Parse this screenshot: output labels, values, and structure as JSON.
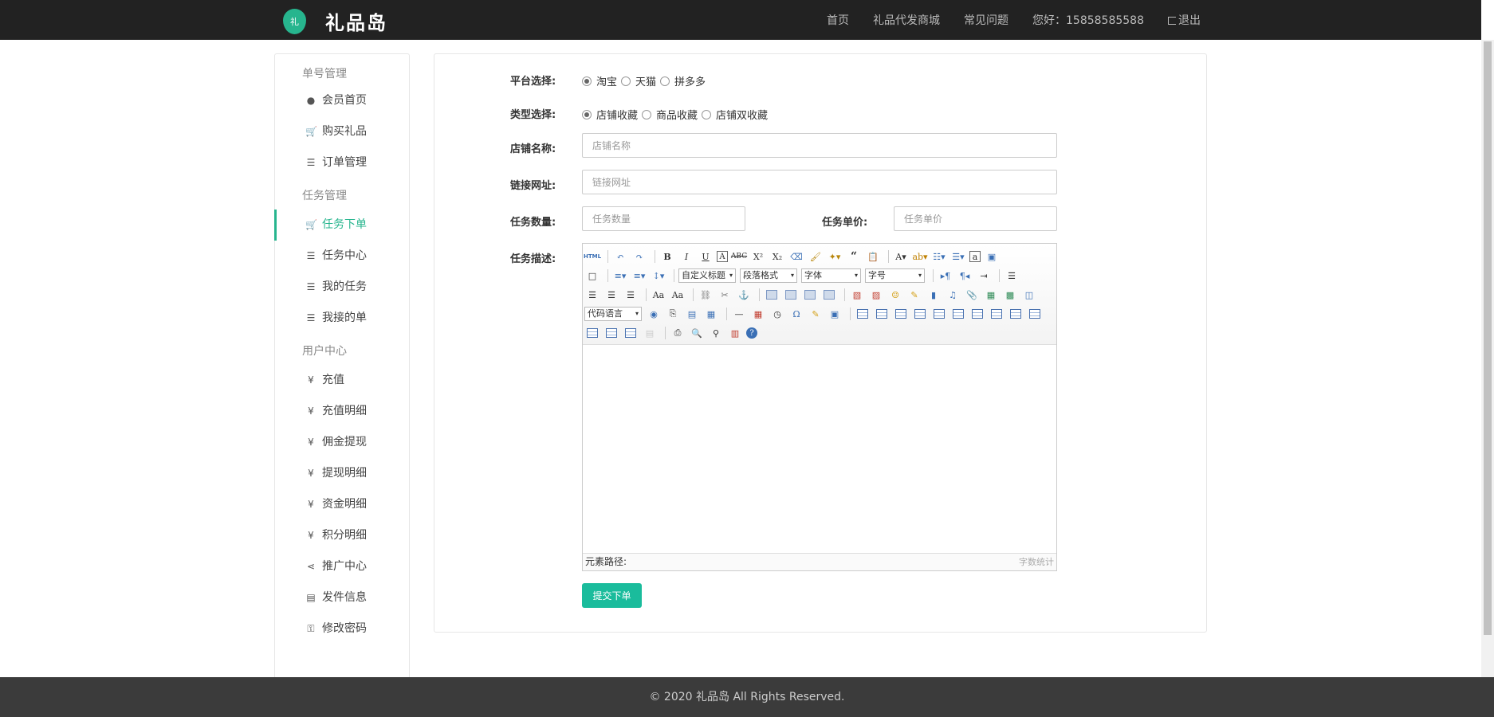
{
  "header": {
    "logo_badge": "礼",
    "logo_text": "礼品岛",
    "nav": [
      "首页",
      "礼品代发商城",
      "常见问题"
    ],
    "greeting": "您好：15858585588",
    "logout": "退出"
  },
  "sidebar": {
    "groups": [
      {
        "title": "单号管理",
        "items": [
          {
            "icon": "user-circle-icon",
            "label": "会员首页"
          },
          {
            "icon": "cart-icon",
            "label": "购买礼品"
          },
          {
            "icon": "list-icon",
            "label": "订单管理"
          }
        ]
      },
      {
        "title": "任务管理",
        "items": [
          {
            "icon": "cart-icon",
            "label": "任务下单",
            "active": true
          },
          {
            "icon": "list-icon",
            "label": "任务中心"
          },
          {
            "icon": "list-icon",
            "label": "我的任务"
          },
          {
            "icon": "list-icon",
            "label": "我接的单"
          }
        ]
      },
      {
        "title": "用户中心",
        "items": [
          {
            "icon": "yen-icon",
            "label": "充值"
          },
          {
            "icon": "yen-icon",
            "label": "充值明细"
          },
          {
            "icon": "yen-icon",
            "label": "佣金提现"
          },
          {
            "icon": "yen-icon",
            "label": "提现明细"
          },
          {
            "icon": "yen-icon",
            "label": "资金明细"
          },
          {
            "icon": "yen-icon",
            "label": "积分明细"
          },
          {
            "icon": "share-icon",
            "label": "推广中心"
          },
          {
            "icon": "id-card-icon",
            "label": "发件信息"
          },
          {
            "icon": "key-icon",
            "label": "修改密码"
          }
        ]
      }
    ]
  },
  "form": {
    "platform_label": "平台选择:",
    "platform_options": [
      "淘宝",
      "天猫",
      "拼多多"
    ],
    "platform_selected": "淘宝",
    "type_label": "类型选择:",
    "type_options": [
      "店铺收藏",
      "商品收藏",
      "店铺双收藏"
    ],
    "type_selected": "店铺收藏",
    "shop_label": "店铺名称:",
    "shop_placeholder": "店铺名称",
    "url_label": "链接网址:",
    "url_placeholder": "链接网址",
    "qty_label": "任务数量:",
    "qty_placeholder": "任务数量",
    "price_label": "任务单价:",
    "price_placeholder": "任务单价",
    "desc_label": "任务描述:",
    "submit": "提交下单"
  },
  "editor": {
    "html_btn": "HTML",
    "custom_title": "自定义标题",
    "paragraph": "段落格式",
    "font": "字体",
    "font_size": "字号",
    "code_lang": "代码语言",
    "path_label": "元素路径:",
    "word_count": "字数统计"
  },
  "footer": {
    "text": "© 2020 礼品岛 All Rights Reserved."
  },
  "colors": {
    "accent": "#27b58e",
    "submit": "#1abc9c",
    "header_bg": "#222222",
    "footer_bg": "#3b3b3b"
  }
}
